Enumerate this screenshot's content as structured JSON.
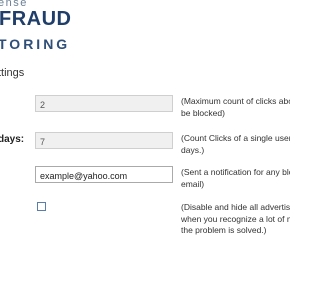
{
  "logo": {
    "line1": "ense",
    "line2": "FRAUD",
    "line3": "TORING"
  },
  "section_title": "ttings",
  "rows": [
    {
      "label": "",
      "value": "2",
      "description": "(Maximum count of clicks abo\nbe blocked)"
    },
    {
      "label": "days:",
      "value": "7",
      "description": "(Count Clicks of a single user\ndays.)"
    },
    {
      "label": "",
      "value": "example@yahoo.com",
      "description": "(Sent a notification for any blo\nemail)"
    },
    {
      "label": "",
      "checked": false,
      "description": "(Disable and hide all advertis\nwhen you recognize a lot of m\nthe problem is solved.)"
    }
  ]
}
